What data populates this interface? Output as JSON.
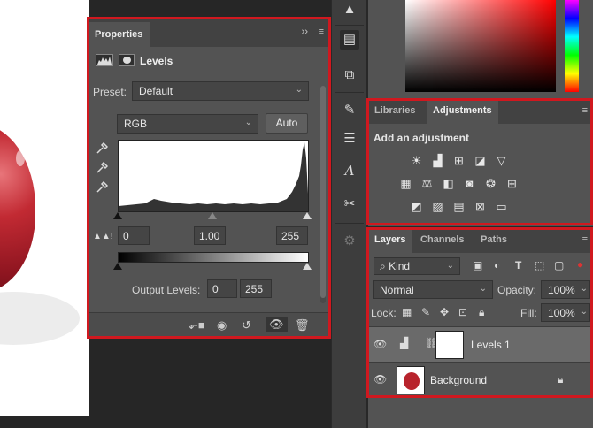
{
  "properties": {
    "tab_label": "Properties",
    "collapse_glyph": "››",
    "menu_glyph": "≡",
    "title": "Levels",
    "preset_label": "Preset:",
    "preset_value": "Default",
    "channel_value": "RGB",
    "auto_label": "Auto",
    "input_black": "0",
    "input_gamma": "1.00",
    "input_white": "255",
    "output_label": "Output Levels:",
    "output_black": "0",
    "output_white": "255"
  },
  "adjustments_panel": {
    "tabs": [
      "Libraries",
      "Adjustments"
    ],
    "active_tab": "Adjustments",
    "heading": "Add an adjustment",
    "menu_glyph": "≡",
    "icons_row1": [
      "brightness-contrast-icon",
      "levels-icon",
      "curves-icon",
      "exposure-icon",
      "vibrance-icon"
    ],
    "icons_row2": [
      "hue-saturation-icon",
      "color-balance-icon",
      "black-white-icon",
      "photo-filter-icon",
      "channel-mixer-icon",
      "color-lookup-icon"
    ],
    "icons_row3": [
      "invert-icon",
      "posterize-icon",
      "threshold-icon",
      "selective-color-icon",
      "gradient-map-icon"
    ]
  },
  "layers_panel": {
    "tabs": [
      "Layers",
      "Channels",
      "Paths"
    ],
    "active_tab": "Layers",
    "menu_glyph": "≡",
    "filter_value": "Kind",
    "blend_mode": "Normal",
    "opacity_label": "Opacity:",
    "opacity_value": "100%",
    "lock_label": "Lock:",
    "fill_label": "Fill:",
    "fill_value": "100%",
    "layers": [
      {
        "name": "Levels 1",
        "selected": true,
        "visible": true
      },
      {
        "name": "Background",
        "selected": false,
        "visible": true,
        "locked": true
      }
    ]
  },
  "colors": {
    "highlight_red": "#d0181f",
    "panel_bg": "#535353",
    "panel_dark": "#424242"
  }
}
